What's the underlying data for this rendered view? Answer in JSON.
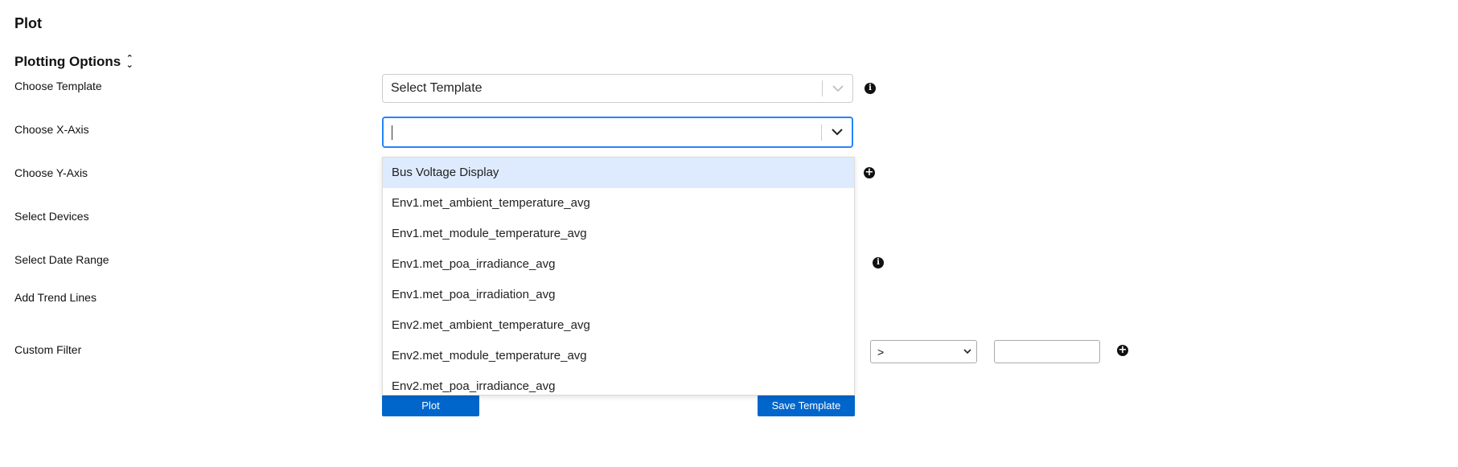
{
  "page": {
    "title": "Plot"
  },
  "section": {
    "title": "Plotting Options",
    "chevron_icon": "chevron-up-down-icon"
  },
  "fields": {
    "template": {
      "label": "Choose Template",
      "value": "Select Template"
    },
    "x_axis": {
      "label": "Choose X-Axis",
      "value": ""
    },
    "y_axis": {
      "label": "Choose Y-Axis"
    },
    "devices": {
      "label": "Select Devices"
    },
    "date_range": {
      "label": "Select Date Range"
    },
    "trend_lines": {
      "label": "Add Trend Lines"
    },
    "custom_filter": {
      "label": "Custom Filter",
      "operator": ">",
      "value": ""
    }
  },
  "dropdown": {
    "options": [
      "Bus Voltage Display",
      "Env1.met_ambient_temperature_avg",
      "Env1.met_module_temperature_avg",
      "Env1.met_poa_irradiance_avg",
      "Env1.met_poa_irradiation_avg",
      "Env2.met_ambient_temperature_avg",
      "Env2.met_module_temperature_avg",
      "Env2.met_poa_irradiance_avg"
    ],
    "highlighted_index": 0
  },
  "buttons": {
    "plot": "Plot",
    "save_template": "Save Template"
  },
  "colors": {
    "primary": "#0066cc",
    "focus": "#2684ff",
    "highlight": "#deebff"
  }
}
